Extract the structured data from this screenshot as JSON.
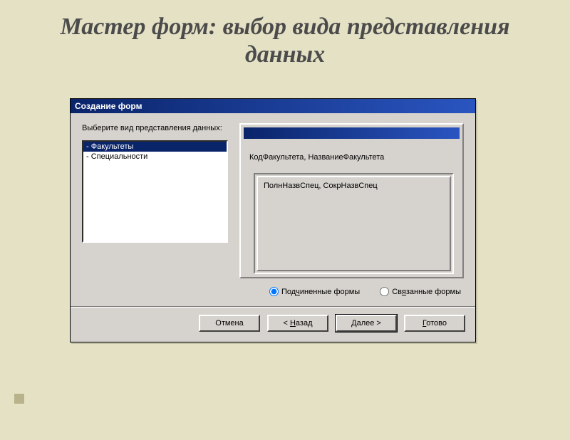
{
  "slide": {
    "title": "Мастер форм: выбор вида представления данных"
  },
  "dialog": {
    "title": "Создание форм",
    "prompt": "Выберите вид представления данных:",
    "list": {
      "items": [
        {
          "label": "- Факультеты",
          "selected": true
        },
        {
          "label": "- Специальности",
          "selected": false
        }
      ]
    },
    "preview": {
      "master_fields": "КодФакультета, НазваниеФакультета",
      "sub_fields": "ПолнНазвСпец, СокрНазвСпец"
    },
    "radios": {
      "sub_label_pre": "Под",
      "sub_label_accel": "ч",
      "sub_label_post": "иненные формы",
      "linked_label_pre": "Св",
      "linked_label_accel": "я",
      "linked_label_post": "занные формы",
      "selected": "sub"
    },
    "buttons": {
      "cancel": "Отмена",
      "back_lt": "< ",
      "back_accel": "Н",
      "back_post": "азад",
      "next_accel": "Д",
      "next_post": "алее >",
      "finish_accel": "Г",
      "finish_post": "отово"
    }
  }
}
